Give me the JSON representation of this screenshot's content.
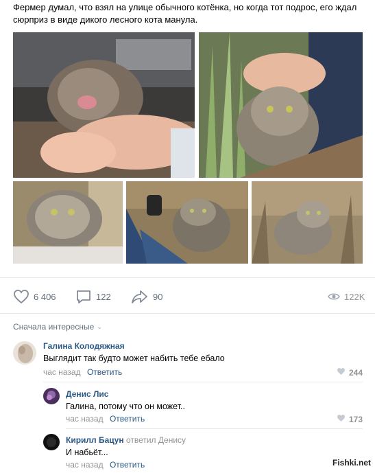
{
  "post": {
    "text": "Фермер думал, что взял на улице обычного котёнка, но когда тот подрос, его ждал сюрприз в виде дикого лесного кота манула.",
    "photos": [
      {
        "name": "photo-kitten-in-hands"
      },
      {
        "name": "photo-kitten-in-grass"
      },
      {
        "name": "photo-manul-closeup"
      },
      {
        "name": "photo-manul-with-person"
      },
      {
        "name": "photo-manul-in-field"
      }
    ]
  },
  "actions": {
    "likes": "6 406",
    "comments": "122",
    "shares": "90",
    "views": "122K",
    "icons": {
      "like": "heart-icon",
      "comment": "comment-icon",
      "share": "share-icon",
      "views": "eye-icon"
    }
  },
  "comments_header": {
    "sort_label": "Сначала интересные"
  },
  "comments": [
    {
      "author": "Галина Колодяжная",
      "text": "Выглядит так будто может набить тебе ебало",
      "time": "час назад",
      "reply_label": "Ответить",
      "likes": "244"
    },
    {
      "author": "Денис Лис",
      "text": "Галина, потому что он может..",
      "time": "час назад",
      "reply_label": "Ответить",
      "likes": "173"
    },
    {
      "author": "Кирилл Бацун",
      "reply_to": "ответил Денису",
      "text": "И набьёт...",
      "time": "час назад",
      "reply_label": "Ответить"
    }
  ],
  "watermark": "Fishki.net",
  "colors": {
    "link": "#2a5885",
    "meta": "#939393",
    "action": "#626d7a",
    "divider": "#e7e8ec"
  }
}
